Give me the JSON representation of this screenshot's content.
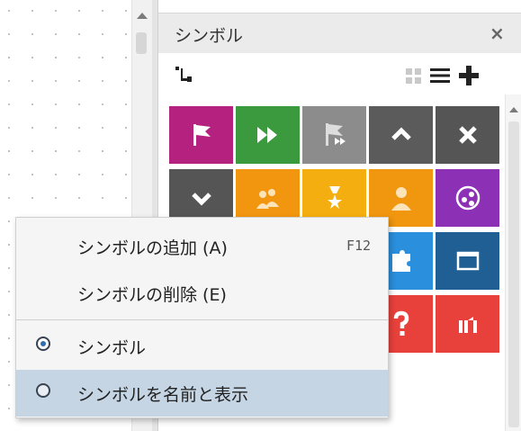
{
  "panel": {
    "title": "シンボル",
    "close_label": "×"
  },
  "toolbar": {
    "icons": [
      "hierarchy-icon",
      "grid-view-icon",
      "list-view-icon",
      "add-icon"
    ]
  },
  "tiles": [
    {
      "icon": "flag-icon",
      "color": "#b5217e"
    },
    {
      "icon": "fast-forward-icon",
      "color": "#3a9a3d"
    },
    {
      "icon": "flag-forward-icon",
      "color": "#8c8c8c"
    },
    {
      "icon": "chevron-up-icon",
      "color": "#5b5b5b"
    },
    {
      "icon": "close-icon",
      "color": "#555555"
    },
    {
      "icon": "chevron-down-icon",
      "color": "#555555"
    },
    {
      "icon": "group-icon",
      "color": "#f2950f"
    },
    {
      "icon": "award-icon",
      "color": "#f5ae0f"
    },
    {
      "icon": "person-icon",
      "color": "#f0960f"
    },
    {
      "icon": "share-icon",
      "color": "#8c31b5"
    },
    {
      "icon": "tile-red",
      "color": "#e8413b"
    },
    {
      "icon": "tile-red-2",
      "color": "#e8413b"
    },
    {
      "icon": "tile-blue",
      "color": "#2196e0"
    },
    {
      "icon": "puzzle-icon",
      "color": "#2a8fdc"
    },
    {
      "icon": "window-icon",
      "color": "#1f5f94"
    },
    {
      "icon": "tile-red-3",
      "color": "#e8413b"
    },
    {
      "icon": "tile-red-4",
      "color": "#e8413b"
    },
    {
      "icon": "tile-red-5",
      "color": "#e8413b"
    },
    {
      "icon": "question-icon",
      "color": "#e8413b"
    },
    {
      "icon": "gate-icon",
      "color": "#e8413b"
    }
  ],
  "context_menu": {
    "items": [
      {
        "label": "シンボルの追加 (A)",
        "shortcut": "F12",
        "type": "command"
      },
      {
        "label": "シンボルの削除 (E)",
        "shortcut": "",
        "type": "command"
      },
      {
        "label": "シンボル",
        "type": "radio",
        "checked": true
      },
      {
        "label": "シンボルを名前と表示",
        "type": "radio",
        "checked": false,
        "highlighted": true
      }
    ]
  },
  "colors": {
    "highlight": "#c5d5e4",
    "menu_bg": "#f5f5f5",
    "panel_header": "#ebebeb"
  }
}
